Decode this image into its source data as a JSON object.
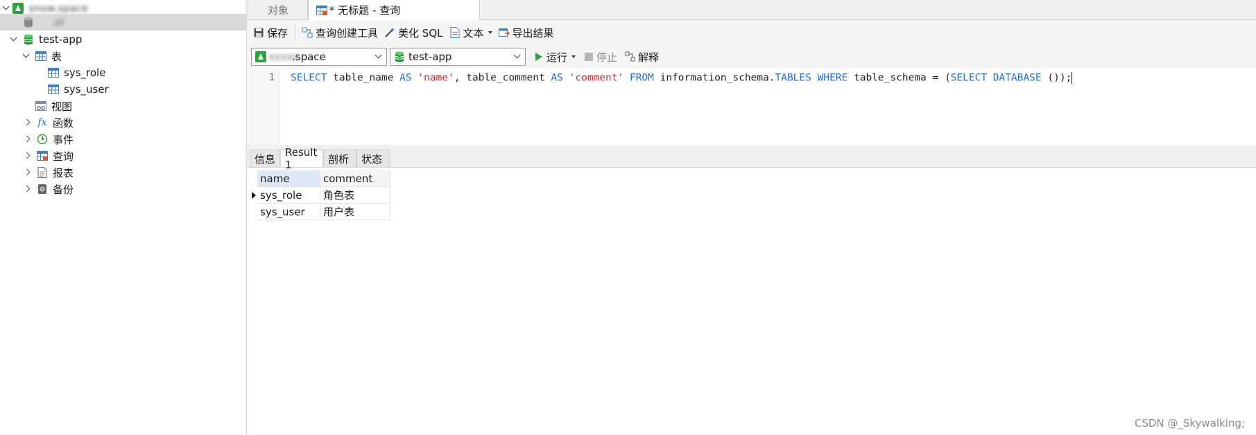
{
  "tree": {
    "connection": "snow.space",
    "schema_blurred": ".ol",
    "database": "test-app",
    "tables_label": "表",
    "tables": [
      "sys_role",
      "sys_user"
    ],
    "views_label": "视图",
    "functions_label": "函数",
    "events_label": "事件",
    "queries_label": "查询",
    "reports_label": "报表",
    "backups_label": "备份"
  },
  "tabs": {
    "objects": "对象",
    "query": "* 无标题 - 查询"
  },
  "toolbar": {
    "save": "保存",
    "query_builder": "查询创建工具",
    "beautify": "美化 SQL",
    "text": "文本",
    "export": "导出结果"
  },
  "selectors": {
    "connection": ".space",
    "database": "test-app",
    "run": "运行",
    "stop": "停止",
    "explain": "解释"
  },
  "editor": {
    "line_number": "1",
    "tokens": [
      {
        "t": "SELECT",
        "c": "kw"
      },
      {
        "t": " table_name ",
        "c": ""
      },
      {
        "t": "AS",
        "c": "kw"
      },
      {
        "t": " ",
        "c": ""
      },
      {
        "t": "'name'",
        "c": "str"
      },
      {
        "t": ", table_comment ",
        "c": ""
      },
      {
        "t": "AS",
        "c": "kw"
      },
      {
        "t": " ",
        "c": ""
      },
      {
        "t": "'comment'",
        "c": "str"
      },
      {
        "t": " ",
        "c": ""
      },
      {
        "t": "FROM",
        "c": "kw"
      },
      {
        "t": " information_schema.",
        "c": ""
      },
      {
        "t": "TABLES",
        "c": "kw"
      },
      {
        "t": " ",
        "c": ""
      },
      {
        "t": "WHERE",
        "c": "kw"
      },
      {
        "t": " table_schema = (",
        "c": ""
      },
      {
        "t": "SELECT",
        "c": "kw"
      },
      {
        "t": " ",
        "c": ""
      },
      {
        "t": "DATABASE",
        "c": "kw"
      },
      {
        "t": " ());",
        "c": ""
      }
    ]
  },
  "result_tabs": [
    "信息",
    "Result 1",
    "剖析",
    "状态"
  ],
  "grid": {
    "columns": [
      "name",
      "comment"
    ],
    "rows": [
      [
        "sys_role",
        "角色表"
      ],
      [
        "sys_user",
        "用户表"
      ]
    ]
  },
  "watermark": "CSDN @_Skywalking;",
  "colors": {
    "keyword": "#1f6fe0",
    "string": "#e0202c",
    "db_green": "#2aa43a",
    "table_blue": "#3b7fd1"
  }
}
